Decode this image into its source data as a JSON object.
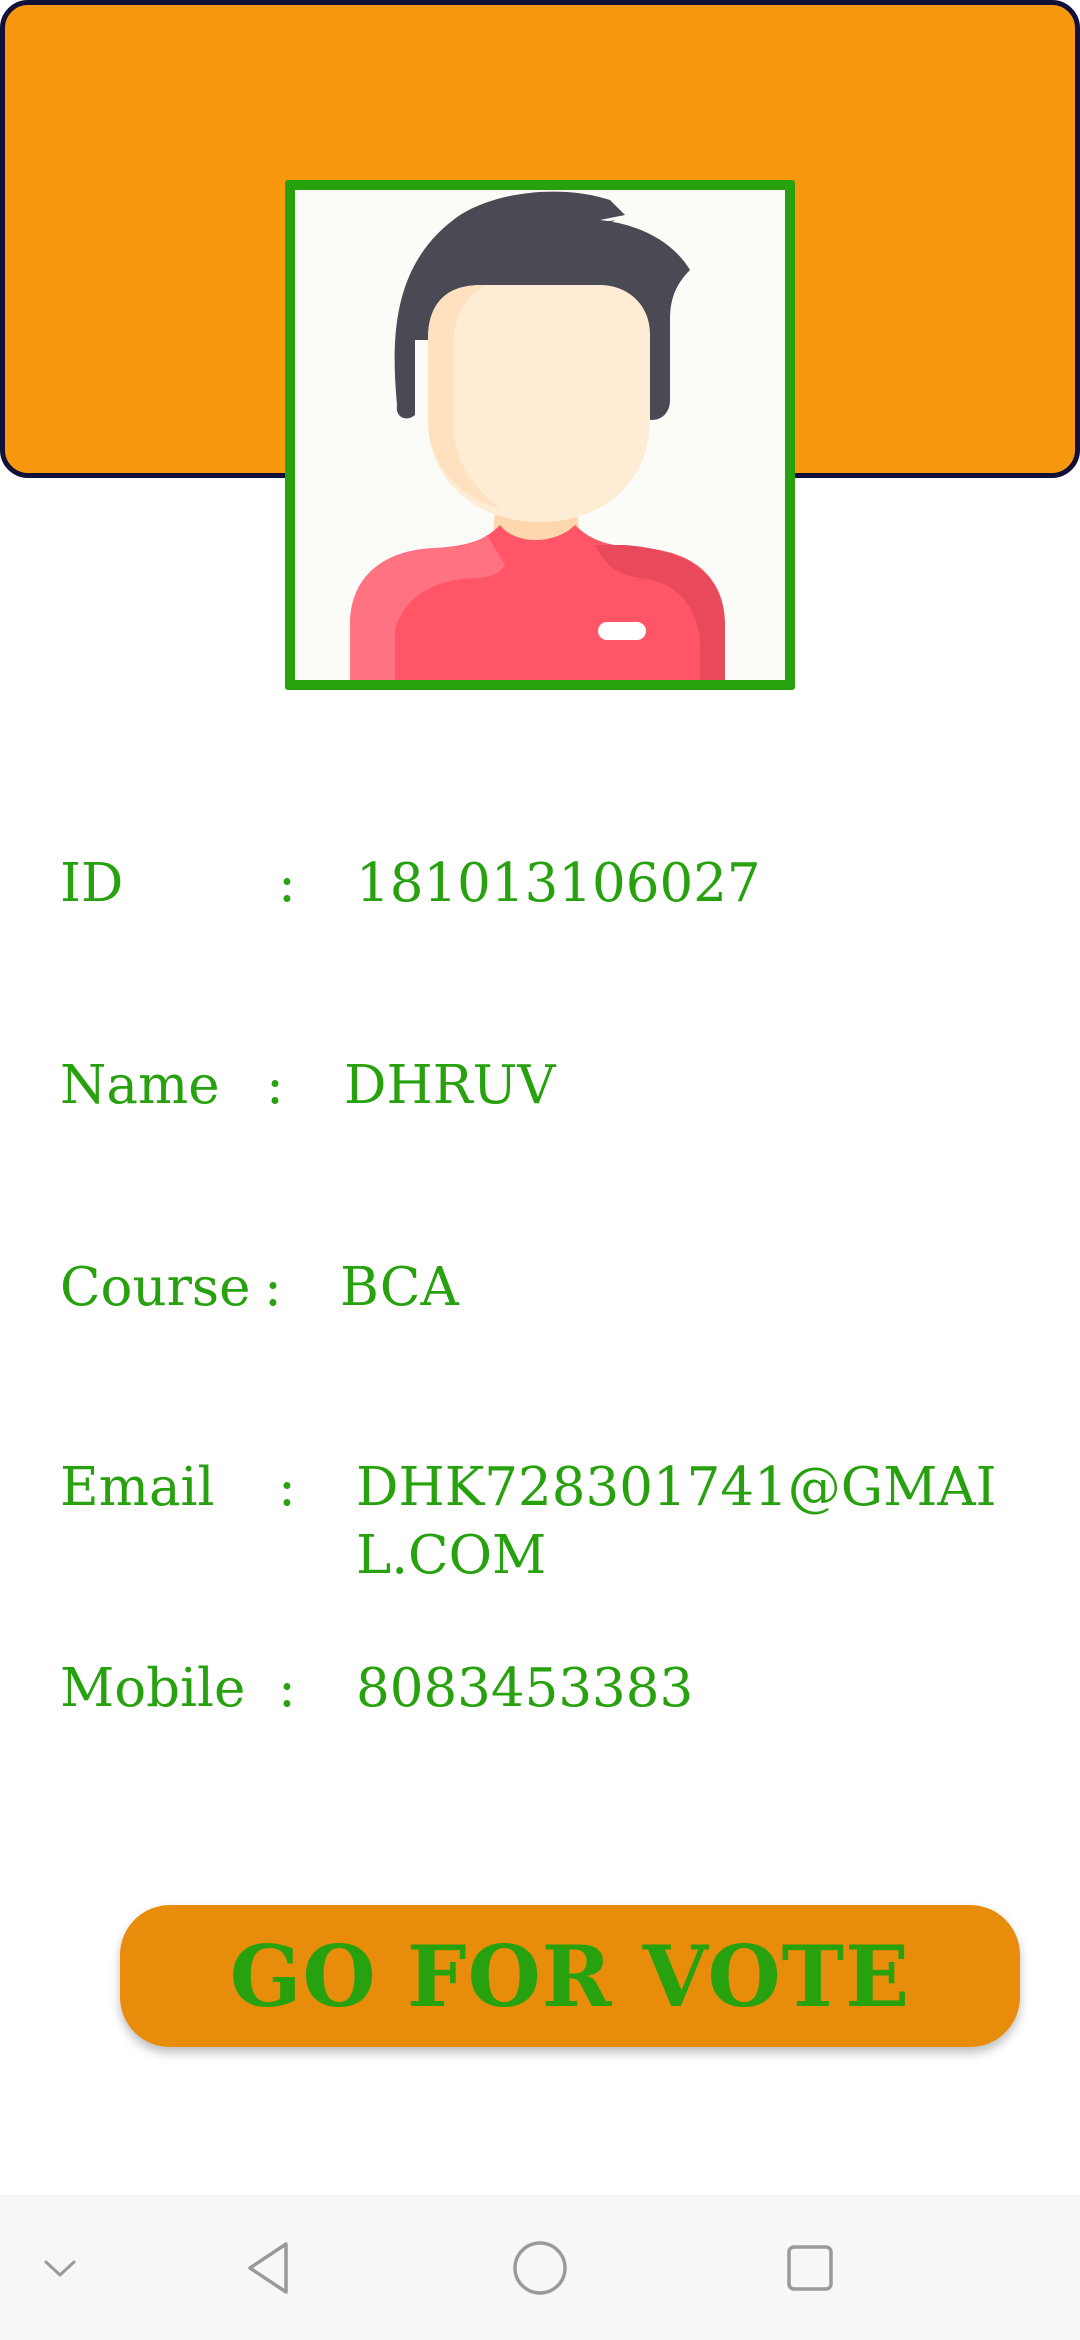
{
  "profile": {
    "avatar_icon": "person-avatar-icon",
    "fields": [
      {
        "label": "ID",
        "value": "181013106027"
      },
      {
        "label": "Name",
        "value": "DHRUV"
      },
      {
        "label": "Course",
        "value": "BCA"
      },
      {
        "label": "Email",
        "value": "DHK728301741@GMAIL.COM"
      },
      {
        "label": "Mobile",
        "value": "8083453383"
      }
    ],
    "separator": ":"
  },
  "vote_button": {
    "label": "GO FOR VOTE"
  },
  "nav_bar": {
    "icons": [
      "chevron-down-icon",
      "back-triangle-icon",
      "home-circle-icon",
      "recents-square-icon"
    ]
  },
  "colors": {
    "header": "#F7980F",
    "accent_green": "#27A10E",
    "button": "#E88C0C"
  }
}
